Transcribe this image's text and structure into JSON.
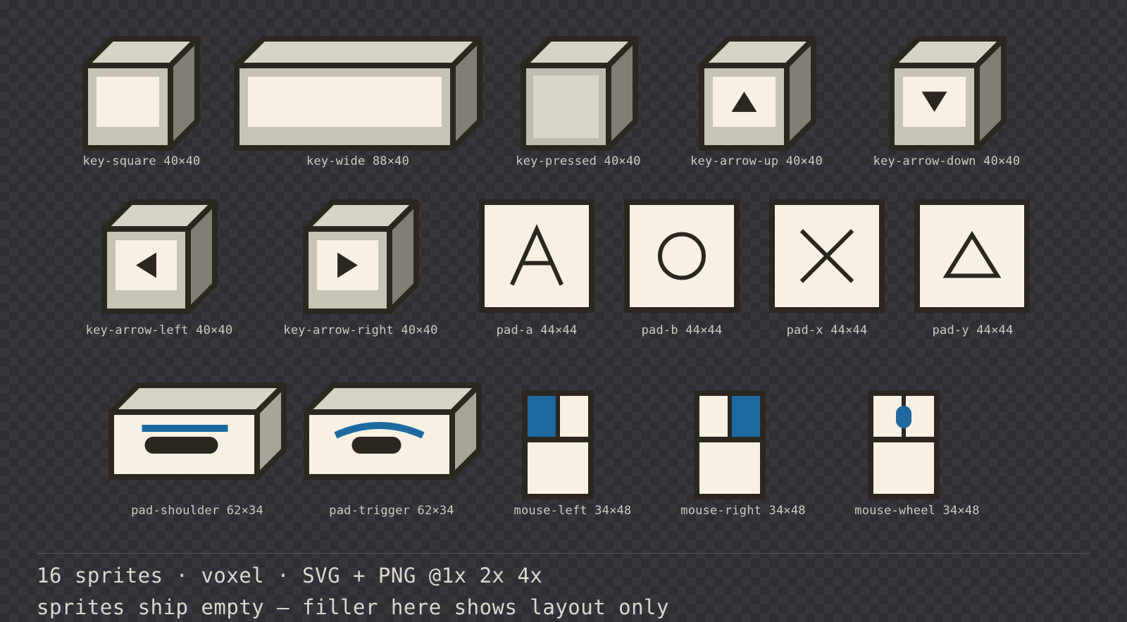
{
  "sprites": [
    {
      "kind": "key",
      "glyph": "none",
      "label": "key-square 40×40"
    },
    {
      "kind": "key",
      "glyph": "none",
      "label": "key-wide 88×40"
    },
    {
      "kind": "key",
      "glyph": "none",
      "state": "pressed",
      "label": "key-pressed 40×40"
    },
    {
      "kind": "key",
      "glyph": "arrow-up",
      "label": "key-arrow-up 40×40"
    },
    {
      "kind": "key",
      "glyph": "arrow-down",
      "label": "key-arrow-down 40×40"
    },
    {
      "kind": "key",
      "glyph": "arrow-left",
      "label": "key-arrow-left 40×40"
    },
    {
      "kind": "key",
      "glyph": "arrow-right",
      "label": "key-arrow-right 40×40"
    },
    {
      "kind": "pad",
      "glyph": "a",
      "label": "pad-a 44×44"
    },
    {
      "kind": "pad",
      "glyph": "b",
      "label": "pad-b 44×44"
    },
    {
      "kind": "pad",
      "glyph": "x",
      "label": "pad-x 44×44"
    },
    {
      "kind": "pad",
      "glyph": "y",
      "label": "pad-y 44×44"
    },
    {
      "kind": "bumper",
      "glyph": "shoulder",
      "label": "pad-shoulder 62×34"
    },
    {
      "kind": "bumper",
      "glyph": "trigger",
      "label": "pad-trigger 62×34"
    },
    {
      "kind": "mouse",
      "glyph": "left",
      "label": "mouse-left 34×48"
    },
    {
      "kind": "mouse",
      "glyph": "right",
      "label": "mouse-right 34×48"
    },
    {
      "kind": "mouse",
      "glyph": "wheel",
      "label": "mouse-wheel 34×48"
    }
  ],
  "footer": {
    "line1": "16 sprites · voxel · SVG + PNG @1x 2x 4x",
    "line2": "sprites ship empty — filler here shows layout only"
  },
  "colors": {
    "outline": "#2b261f",
    "top": "#d8d3c7",
    "side": "#807e75",
    "front": "#c7c3b7",
    "pressed_front": "#bfbbb0",
    "pressed_inner": "#d9d5c8",
    "face": "#f6f1e4",
    "accent": "#1e6aa0"
  }
}
